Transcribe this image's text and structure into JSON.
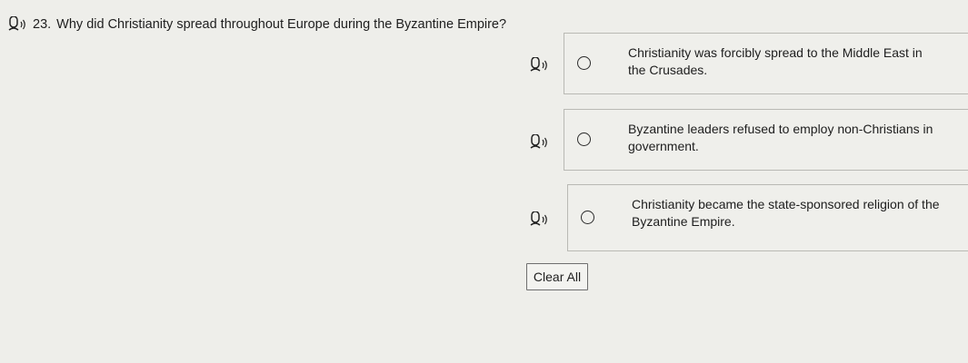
{
  "question": {
    "number": "23.",
    "text": "Why did Christianity spread throughout Europe during the Byzantine Empire?",
    "speaker_icon": "speaker-icon"
  },
  "choices": [
    {
      "label": "Christianity was forcibly spread to the Middle East in the Crusades."
    },
    {
      "label": "Byzantine leaders refused to employ non-Christians in government."
    },
    {
      "label": "Christianity became the state-sponsored religion of the Byzantine Empire."
    }
  ],
  "actions": {
    "clear_label": "Clear All"
  },
  "colors": {
    "background": "#eeeeea",
    "text": "#1e1e1e",
    "border": "#b9b9b4"
  }
}
